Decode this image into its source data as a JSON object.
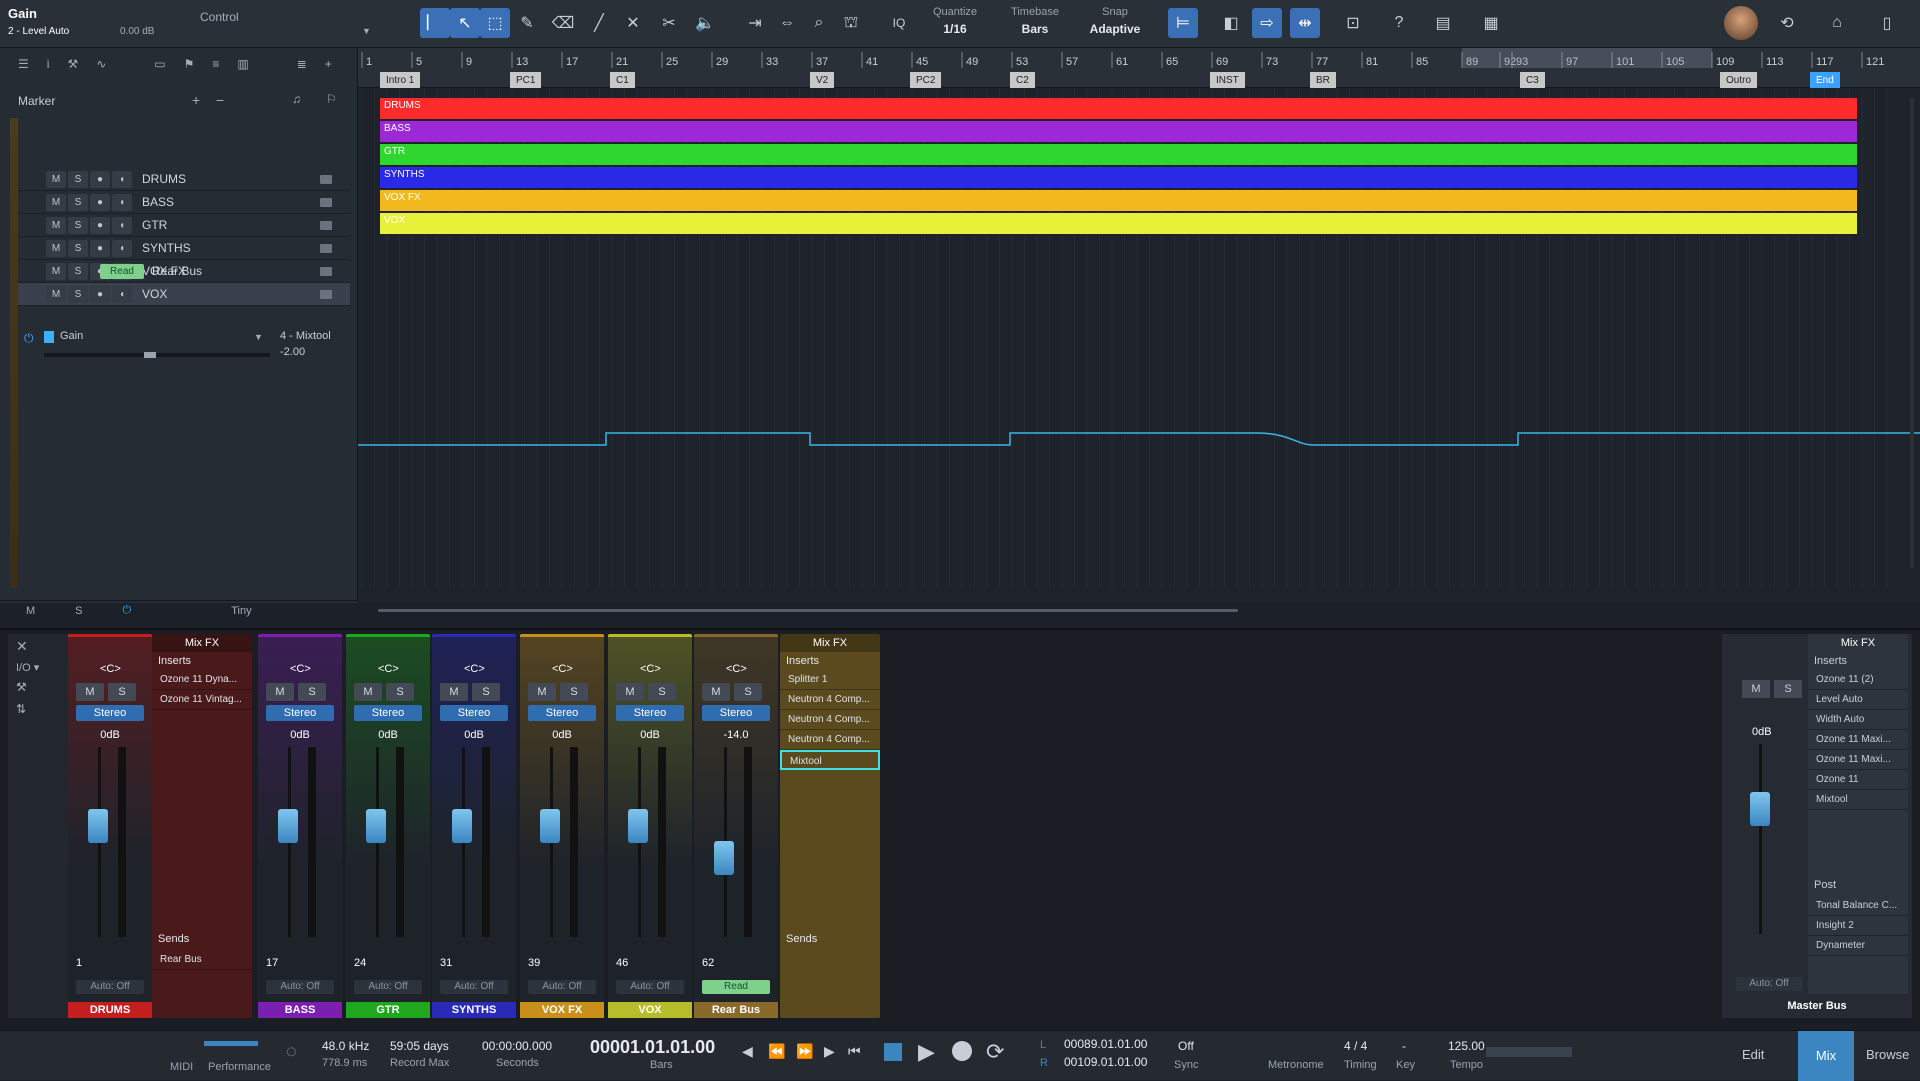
{
  "toolbar": {
    "track_name": "Gain",
    "track_sub": "2 - Level Auto",
    "value": "0.00 dB",
    "control_label": "Control",
    "quantize_label": "Quantize",
    "quantize_value": "1/16",
    "timebase_label": "Timebase",
    "timebase_value": "Bars",
    "snap_label": "Snap",
    "snap_value": "Adaptive",
    "iq_label": "IQ"
  },
  "track_panel": {
    "marker_label": "Marker",
    "tracks": [
      {
        "name": "DRUMS",
        "color": "#ff2a2a"
      },
      {
        "name": "BASS",
        "color": "#9b2ad6"
      },
      {
        "name": "GTR",
        "color": "#2ed62e"
      },
      {
        "name": "SYNTHS",
        "color": "#2a2ae6"
      },
      {
        "name": "VOX FX",
        "color": "#f2b81e"
      },
      {
        "name": "VOX",
        "color": "#e8f03a"
      }
    ],
    "rear_bus": "Rear Bus",
    "read_label": "Read",
    "gain_label": "Gain",
    "mix_tool": "4 - Mixtool",
    "gain_value": "-2.00",
    "bottom_m": "M",
    "bottom_s": "S",
    "size_label": "Tiny"
  },
  "ruler": {
    "bars": [
      "1",
      "5",
      "9",
      "13",
      "17",
      "21",
      "25",
      "29",
      "33",
      "37",
      "41",
      "45",
      "49",
      "53",
      "57",
      "61",
      "65",
      "69",
      "73",
      "77",
      "81",
      "85",
      "89",
      "92",
      "93",
      "97",
      "101",
      "105",
      "109",
      "113",
      "117",
      "121"
    ],
    "markers": [
      {
        "label": "Intro 1"
      },
      {
        "label": "PC1"
      },
      {
        "label": "C1"
      },
      {
        "label": "V2"
      },
      {
        "label": "PC2"
      },
      {
        "label": "C2"
      },
      {
        "label": "INST"
      },
      {
        "label": "BR"
      },
      {
        "label": "C3"
      },
      {
        "label": "Outro"
      },
      {
        "label": "End"
      }
    ]
  },
  "mixer": {
    "strips": [
      {
        "name": "DRUMS",
        "color": "#c41f1f",
        "db": "0dB",
        "num": "1",
        "auto": "Auto: Off",
        "fader": 0.6
      },
      {
        "name": "BASS",
        "color": "#7a1fb0",
        "db": "0dB",
        "num": "17",
        "auto": "Auto: Off",
        "fader": 0.6
      },
      {
        "name": "GTR",
        "color": "#1fa81f",
        "db": "0dB",
        "num": "24",
        "auto": "Auto: Off",
        "fader": 0.6
      },
      {
        "name": "SYNTHS",
        "color": "#2a2ab8",
        "db": "0dB",
        "num": "31",
        "auto": "Auto: Off",
        "fader": 0.6
      },
      {
        "name": "VOX FX",
        "color": "#c8901a",
        "db": "0dB",
        "num": "39",
        "auto": "Auto: Off",
        "fader": 0.6
      },
      {
        "name": "VOX",
        "color": "#b6bc2a",
        "db": "0dB",
        "num": "46",
        "auto": "Auto: Off",
        "fader": 0.6
      },
      {
        "name": "Rear Bus",
        "color": "#8a6a2a",
        "db": "-14.0",
        "num": "62",
        "auto": "Read",
        "fader": 0.4
      }
    ],
    "drums_fx": {
      "header": "Mix FX",
      "inserts": "Inserts",
      "items": [
        "Ozone 11 Dyna...",
        "Ozone 11 Vintag..."
      ],
      "sends": "Sends",
      "send_item": "Rear Bus"
    },
    "rear_fx": {
      "header": "Mix FX",
      "inserts": "Inserts",
      "items": [
        "Splitter 1",
        "Neutron 4 Comp...",
        "Neutron 4 Comp...",
        "Neutron 4 Comp...",
        "Mixtool"
      ],
      "sends": "Sends"
    },
    "master": {
      "name": "Master Bus",
      "db": "0dB",
      "auto": "Auto: Off",
      "header": "Mix FX",
      "inserts": "Inserts",
      "items": [
        "Ozone 11 (2)",
        "Level Auto",
        "Width Auto",
        "Ozone 11 Maxi...",
        "Ozone 11 Maxi...",
        "Ozone 11",
        "Mixtool"
      ],
      "post": "Post",
      "post_items": [
        "Tonal Balance C...",
        "Insight 2",
        "Dynameter"
      ]
    }
  },
  "transport": {
    "midi": "MIDI",
    "performance": "Performance",
    "sample_rate": "48.0 kHz",
    "latency": "778.9 ms",
    "days": "59:05 days",
    "record_max": "Record Max",
    "time": "00:00:00.000",
    "seconds": "Seconds",
    "position": "00001.01.01.00",
    "bars": "Bars",
    "loop_l": "00089.01.01.00",
    "loop_r": "00109.01.01.00",
    "sync_off": "Off",
    "sync": "Sync",
    "metronome": "Metronome",
    "timing_value": "4 / 4",
    "timing": "Timing",
    "key_value": "-",
    "key": "Key",
    "tempo_value": "125.00",
    "tempo": "Tempo",
    "edit": "Edit",
    "mix": "Mix",
    "browse": "Browse"
  }
}
